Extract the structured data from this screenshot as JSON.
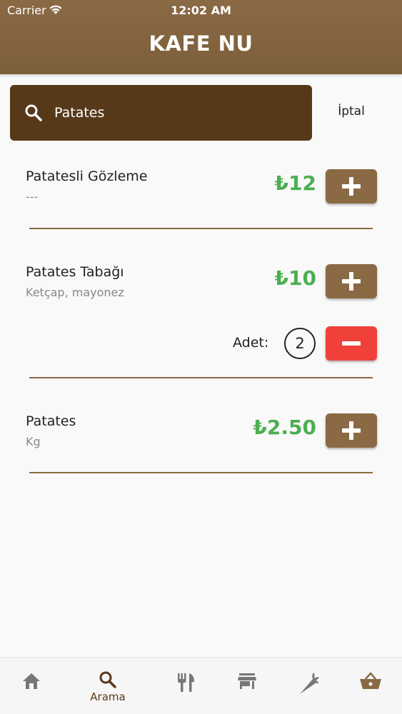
{
  "status_bar": {
    "carrier": "Carrier",
    "time": "12:02 AM"
  },
  "header": {
    "title": "KAFE NU"
  },
  "search": {
    "value": "Patates",
    "cancel_label": "İptal"
  },
  "items": [
    {
      "name": "Patatesli Gözleme",
      "description": "---",
      "price": "₺12"
    },
    {
      "name": "Patates Tabağı",
      "description": "Ketçap, mayonez",
      "price": "₺10",
      "quantity_label": "Adet:",
      "quantity": "2"
    },
    {
      "name": "Patates",
      "description": "Kg",
      "price": "₺2.50"
    }
  ],
  "tabbar": {
    "active_tab": "Arama",
    "tabs": [
      {
        "icon": "home-icon",
        "label": ""
      },
      {
        "icon": "search-icon",
        "label": "Arama"
      },
      {
        "icon": "fork-knife-icon",
        "label": ""
      },
      {
        "icon": "store-icon",
        "label": ""
      },
      {
        "icon": "carrot-icon",
        "label": ""
      },
      {
        "icon": "basket-icon",
        "label": ""
      }
    ]
  },
  "colors": {
    "header": "#8a6a44",
    "search_bg": "#57391a",
    "price": "#4caf50",
    "remove": "#f0403a",
    "divider": "#8a6a44"
  }
}
